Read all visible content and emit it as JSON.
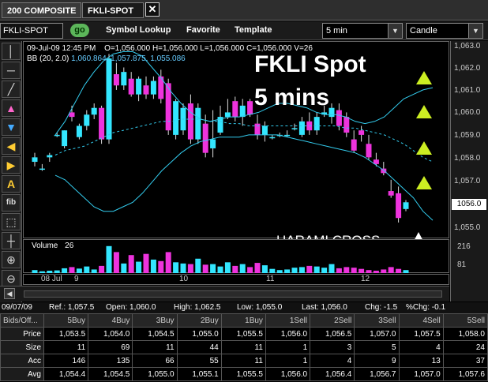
{
  "tabs": [
    {
      "label": "200  COMPOSITE"
    },
    {
      "label": "FKLI-SPOT"
    }
  ],
  "tab_close_icon": "close-icon",
  "toolbar": {
    "symbol_value": "FKLI-SPOT",
    "go_label": "go",
    "symbol_lookup": "Symbol Lookup",
    "favorite": "Favorite",
    "template": "Template",
    "interval": "5 min",
    "chart_style": "Candle"
  },
  "chart_header": {
    "date": "09-Jul-09  12:45 PM",
    "ohlcv": "O=1,056.000   H=1,056.000   L=1,056.000   C=1,056.000   V=26",
    "bb_label": "BB (20, 2.0)",
    "bb_values": "1,060.864,  1,057.875,  1,055.086"
  },
  "annotations": {
    "title_line1": "FKLI Spot",
    "title_line2": "5 mins",
    "pattern": "HARAMI CROSS"
  },
  "volume_header": {
    "label": "Volume",
    "value": "26"
  },
  "price_axis": {
    "ticks": [
      "1,063.0",
      "1,062.0",
      "1,061.0",
      "1,060.0",
      "1,059.0",
      "1,058.0",
      "1,057.0",
      "1,056.0",
      "1,055.0"
    ],
    "current": "1056.0",
    "volume_ticks": [
      "216",
      "81"
    ]
  },
  "date_axis": {
    "start": "08 Jul",
    "labels": [
      "9",
      "10",
      "11",
      "12"
    ]
  },
  "quote": {
    "date": "09/07/09",
    "ref": "Ref.: 1,057.5",
    "open": "Open: 1,060.0",
    "high": "High: 1,062.5",
    "low": "Low: 1,055.0",
    "last": "Last: 1,056.0",
    "chg": "Chg: -1.5",
    "pchg": "%Chg: -0.1"
  },
  "depth": {
    "corner": "Bids/Off...",
    "headers": [
      "5Buy",
      "4Buy",
      "3Buy",
      "2Buy",
      "1Buy",
      "1Sell",
      "2Sell",
      "3Sell",
      "4Sell",
      "5Sell"
    ],
    "rows": [
      {
        "label": "Price",
        "cells": [
          "1,053.5",
          "1,054.0",
          "1,054.5",
          "1,055.0",
          "1,055.5",
          "1,056.0",
          "1,056.5",
          "1,057.0",
          "1,057.5",
          "1,058.0"
        ]
      },
      {
        "label": "Size",
        "cells": [
          "11",
          "69",
          "11",
          "44",
          "11",
          "1",
          "3",
          "5",
          "4",
          "24"
        ]
      },
      {
        "label": "Acc",
        "cells": [
          "146",
          "135",
          "66",
          "55",
          "11",
          "1",
          "4",
          "9",
          "13",
          "37"
        ]
      },
      {
        "label": "Avg",
        "cells": [
          "1,054.4",
          "1,054.5",
          "1,055.0",
          "1,055.1",
          "1,055.5",
          "1,056.0",
          "1,056.4",
          "1,056.7",
          "1,057.0",
          "1,057.6"
        ]
      }
    ]
  },
  "chart_data": {
    "type": "candlestick",
    "ylim": [
      1054.5,
      1063.0
    ],
    "candles": [
      [
        1057.8,
        1058.2,
        1057.6,
        1058.0
      ],
      [
        1057.5,
        1057.7,
        1057.4,
        1057.5
      ],
      [
        1058.0,
        1058.2,
        1057.8,
        1058.1
      ],
      [
        1059.0,
        1059.1,
        1058.9,
        1059.0
      ],
      [
        1058.5,
        1059.2,
        1058.4,
        1059.2
      ],
      [
        1060.0,
        1060.3,
        1059.6,
        1059.8
      ],
      [
        1058.9,
        1059.5,
        1058.8,
        1059.4
      ],
      [
        1059.4,
        1060.1,
        1059.2,
        1059.9
      ],
      [
        1059.9,
        1060.4,
        1059.7,
        1060.2
      ],
      [
        1060.2,
        1060.3,
        1058.6,
        1058.8
      ],
      [
        1058.8,
        1062.6,
        1058.6,
        1062.4
      ],
      [
        1061.7,
        1062.2,
        1061.0,
        1061.2
      ],
      [
        1061.2,
        1062.0,
        1061.0,
        1061.8
      ],
      [
        1061.5,
        1061.8,
        1060.7,
        1060.8
      ],
      [
        1060.8,
        1061.6,
        1060.5,
        1061.5
      ],
      [
        1061.2,
        1061.6,
        1060.6,
        1060.8
      ],
      [
        1060.8,
        1061.6,
        1060.6,
        1061.4
      ],
      [
        1061.6,
        1061.9,
        1060.4,
        1060.6
      ],
      [
        1061.3,
        1061.5,
        1059.0,
        1059.2
      ],
      [
        1059.0,
        1060.6,
        1058.8,
        1060.5
      ],
      [
        1059.2,
        1060.4,
        1059.0,
        1060.2
      ],
      [
        1060.4,
        1060.8,
        1058.6,
        1058.8
      ],
      [
        1058.8,
        1060.4,
        1058.6,
        1060.2
      ],
      [
        1059.5,
        1059.9,
        1058.0,
        1058.2
      ],
      [
        1058.4,
        1060.1,
        1058.0,
        1058.8
      ],
      [
        1059.1,
        1060.3,
        1059.0,
        1059.8
      ],
      [
        1059.8,
        1060.6,
        1059.7,
        1060.0
      ],
      [
        1060.5,
        1060.7,
        1059.6,
        1059.8
      ],
      [
        1059.8,
        1060.6,
        1059.4,
        1060.3
      ],
      [
        1060.5,
        1060.6,
        1059.8,
        1059.9
      ],
      [
        1059.5,
        1059.9,
        1058.8,
        1059.0
      ],
      [
        1059.0,
        1059.6,
        1058.7,
        1059.4
      ],
      [
        1058.9,
        1059.0,
        1058.8,
        1058.9
      ],
      [
        1059.0,
        1059.1,
        1058.9,
        1059.0
      ],
      [
        1059.0,
        1059.2,
        1058.9,
        1059.0
      ],
      [
        1059.3,
        1059.5,
        1059.2,
        1059.3
      ],
      [
        1059.0,
        1059.8,
        1058.9,
        1059.6
      ],
      [
        1059.6,
        1060.0,
        1059.0,
        1059.2
      ],
      [
        1059.2,
        1060.0,
        1059.0,
        1059.8
      ],
      [
        1059.9,
        1060.3,
        1059.8,
        1060.0
      ],
      [
        1059.8,
        1060.4,
        1059.5,
        1060.2
      ],
      [
        1060.1,
        1060.4,
        1059.2,
        1059.4
      ],
      [
        1059.8,
        1060.0,
        1058.9,
        1059.1
      ],
      [
        1058.8,
        1059.2,
        1058.2,
        1058.3
      ],
      [
        1059.2,
        1059.4,
        1058.7,
        1059.0
      ],
      [
        1058.6,
        1059.0,
        1057.9,
        1058.0
      ],
      [
        1057.9,
        1058.2,
        1057.6,
        1057.7
      ],
      [
        1057.5,
        1057.8,
        1057.2,
        1057.3
      ],
      [
        1056.5,
        1057.0,
        1056.2,
        1056.3
      ],
      [
        1056.4,
        1056.7,
        1055.1,
        1055.3
      ],
      [
        1055.7,
        1056.1,
        1055.6,
        1056.0
      ]
    ],
    "bb_upper": [
      1059.0,
      1059.6,
      1060.4,
      1061.2,
      1061.8,
      1062.3,
      1062.6,
      1062.7,
      1062.7,
      1062.5,
      1062.0,
      1061.5,
      1060.9,
      1060.4,
      1060.0,
      1059.7,
      1059.6,
      1059.7,
      1059.8,
      1059.8,
      1059.9,
      1060.0,
      1060.2,
      1060.4,
      1060.4,
      1060.3,
      1060.2,
      1060.0,
      1059.9,
      1059.9,
      1059.8,
      1059.6,
      1059.5,
      1059.6,
      1059.8,
      1060.2,
      1060.6,
      1060.8,
      1061.0,
      1061.1
    ],
    "bb_mid": [
      1058.1,
      1058.3,
      1058.4,
      1058.5,
      1058.7,
      1058.9,
      1059.1,
      1059.2,
      1059.3,
      1059.4,
      1059.5,
      1059.6,
      1059.6,
      1059.7,
      1059.7,
      1059.7,
      1059.6,
      1059.6,
      1059.5,
      1059.5,
      1059.4,
      1059.4,
      1059.4,
      1059.4,
      1059.4,
      1059.4,
      1059.4,
      1059.4,
      1059.4,
      1059.4,
      1059.3,
      1059.3,
      1059.2,
      1059.1,
      1059.0,
      1058.8,
      1058.6,
      1058.3,
      1058.0,
      1057.8
    ],
    "bb_lower": [
      1057.2,
      1057.0,
      1056.6,
      1056.2,
      1055.8,
      1055.6,
      1055.6,
      1055.8,
      1056.0,
      1056.4,
      1056.9,
      1057.4,
      1057.8,
      1058.2,
      1058.5,
      1058.7,
      1058.8,
      1058.9,
      1058.9,
      1058.9,
      1059.0,
      1059.0,
      1059.0,
      1059.0,
      1058.9,
      1058.8,
      1058.7,
      1058.6,
      1058.5,
      1058.4,
      1058.3,
      1058.2,
      1058.0,
      1057.7,
      1057.4,
      1057.0,
      1056.6,
      1056.2,
      1055.6,
      1055.2
    ],
    "volume": [
      10,
      6,
      8,
      9,
      16,
      20,
      15,
      22,
      12,
      24,
      90,
      70,
      32,
      60,
      38,
      64,
      45,
      40,
      70,
      36,
      32,
      30,
      48,
      28,
      30,
      22,
      36,
      24,
      30,
      20,
      34,
      26,
      14,
      10,
      12,
      18,
      20,
      24,
      22,
      18,
      30,
      16,
      20,
      18,
      14,
      10,
      8,
      12,
      20,
      14,
      10
    ]
  }
}
